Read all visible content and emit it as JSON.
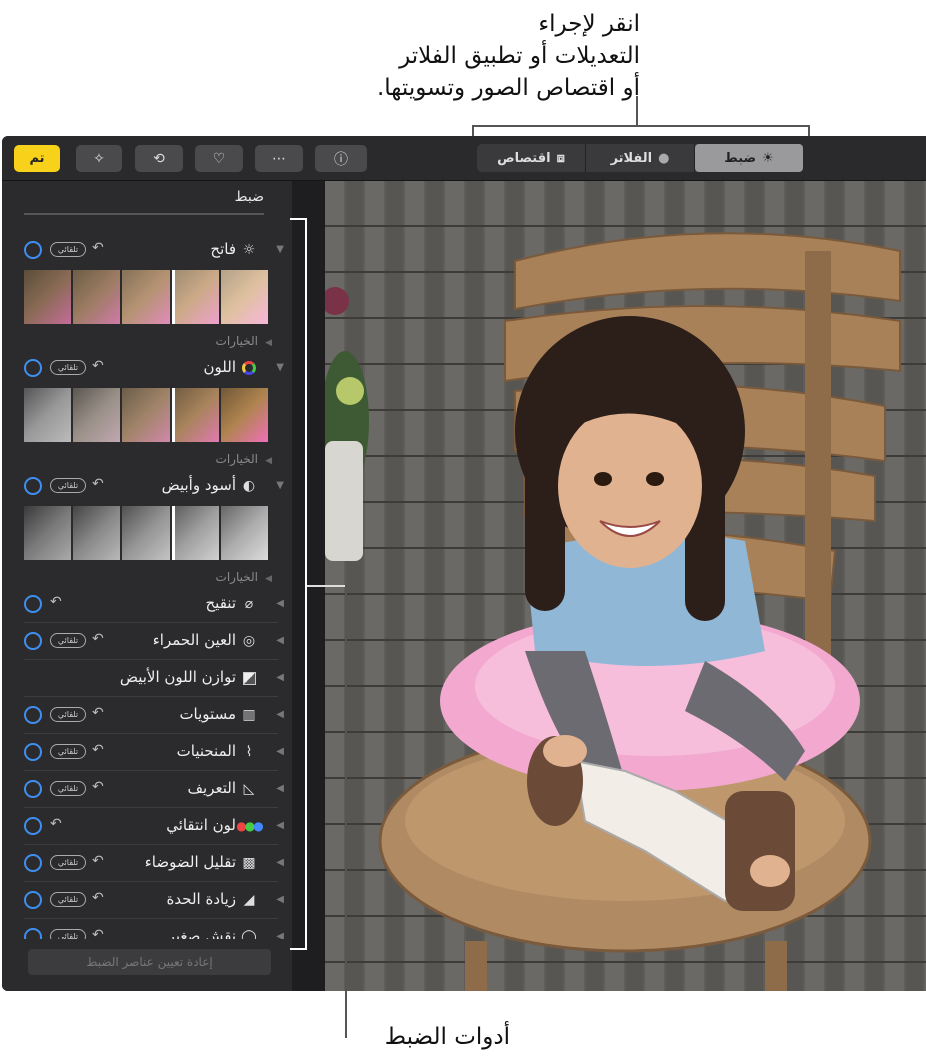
{
  "annotations": {
    "top_line1": "انقر لإجراء",
    "top_line2": "التعديلات أو تطبيق الفلاتر",
    "top_line3": "أو اقتصاص الصور وتسويتها.",
    "bottom": "أدوات الضبط"
  },
  "toolbar": {
    "done_label": "تم",
    "segments": [
      {
        "label": "اقتصاص",
        "icon": "crop-icon"
      },
      {
        "label": "الفلاتر",
        "icon": "filters-icon"
      },
      {
        "label": "ضبط",
        "icon": "adjust-icon",
        "active": true
      }
    ]
  },
  "sidebar": {
    "title": "ضبط",
    "auto_label": "تلقائي",
    "options_label": "الخيارات",
    "sections": [
      {
        "label": "فاتح",
        "icon": "sun-icon"
      },
      {
        "label": "اللون",
        "icon": "color-wheel-icon"
      },
      {
        "label": "أسود وأبيض",
        "icon": "half-circle-icon"
      }
    ],
    "tools": [
      {
        "label": "تنقيح",
        "icon": "bandage-icon",
        "auto": false
      },
      {
        "label": "العين الحمراء",
        "icon": "eye-icon",
        "auto": true
      },
      {
        "label": "توازن اللون الأبيض",
        "icon": "white-balance-icon",
        "auto": false,
        "no_controls": true
      },
      {
        "label": "مستويات",
        "icon": "levels-icon",
        "auto": true
      },
      {
        "label": "المنحنيات",
        "icon": "curves-icon",
        "auto": true
      },
      {
        "label": "التعريف",
        "icon": "definition-icon",
        "auto": true
      },
      {
        "label": "لون انتقائي",
        "icon": "selective-color-icon",
        "auto": false
      },
      {
        "label": "تقليل الضوضاء",
        "icon": "noise-icon",
        "auto": true
      },
      {
        "label": "زيادة الحدة",
        "icon": "sharpen-icon",
        "auto": true
      },
      {
        "label": "نقش صغير",
        "icon": "vignette-icon",
        "auto": true
      }
    ],
    "reset_label": "إعادة تعيين عناصر الضبط"
  },
  "colors": {
    "accent_blue": "#3f8ff0",
    "done_yellow": "#f7d11a"
  }
}
